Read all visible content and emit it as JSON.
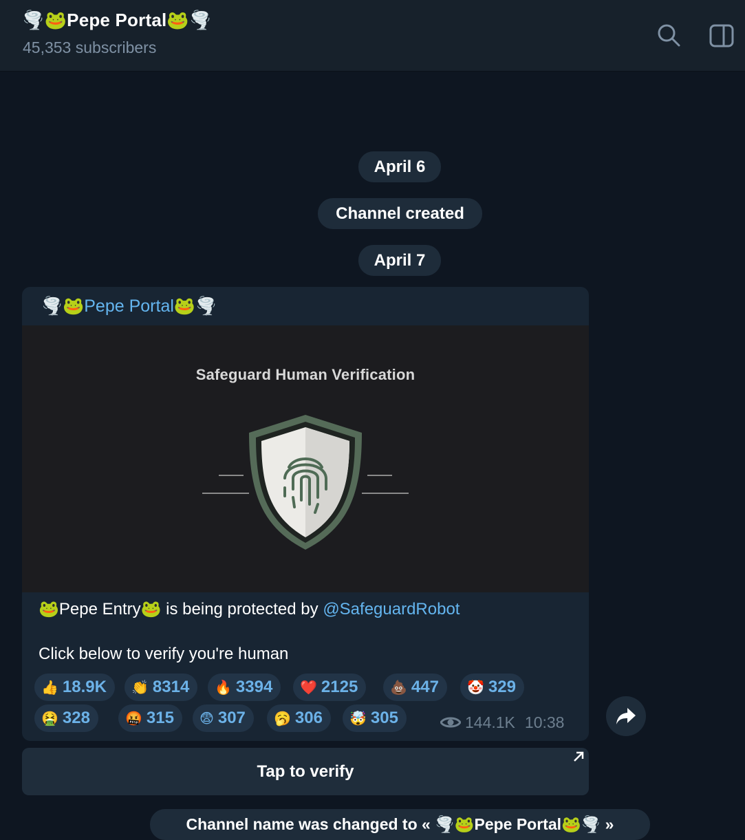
{
  "header": {
    "title": "🌪️🐸Pepe Portal🐸🌪️",
    "subscribers": "45,353 subscribers",
    "search_icon": "search-icon",
    "panel_icon": "sidebar-toggle-icon"
  },
  "service_messages": {
    "date1": "April 6",
    "created": "Channel created",
    "date2": "April 7",
    "name_changed": "Channel name was changed to « 🌪️🐸Pepe Portal🐸🌪️ »"
  },
  "post": {
    "sender": "🌪️🐸Pepe Portal🐸🌪️",
    "media_title": "Safeguard Human Verification",
    "text_part1": "🐸Pepe Entry🐸 is being protected by ",
    "text_link": "@SafeguardRobot",
    "text_line2": "Click below to verify you're human",
    "reactions": [
      {
        "emoji": "👍",
        "count": "18.9K"
      },
      {
        "emoji": "👏",
        "count": "8314"
      },
      {
        "emoji": "🔥",
        "count": "3394"
      },
      {
        "emoji": "❤️",
        "count": "2125"
      },
      {
        "emoji": "💩",
        "count": "447"
      },
      {
        "emoji": "🤡",
        "count": "329"
      },
      {
        "emoji": "🤮",
        "count": "328"
      },
      {
        "emoji": "🤬",
        "count": "315"
      },
      {
        "emoji": "😨",
        "count": "307"
      },
      {
        "emoji": "🥱",
        "count": "306"
      },
      {
        "emoji": "🤯",
        "count": "305"
      }
    ],
    "views": "144.1K",
    "time": "10:38",
    "button_label": "Tap to verify"
  },
  "colors": {
    "background": "#0e1621",
    "header": "#17212b",
    "bubble": "#182533",
    "link": "#64b5ef",
    "reaction_bg": "#223447"
  }
}
